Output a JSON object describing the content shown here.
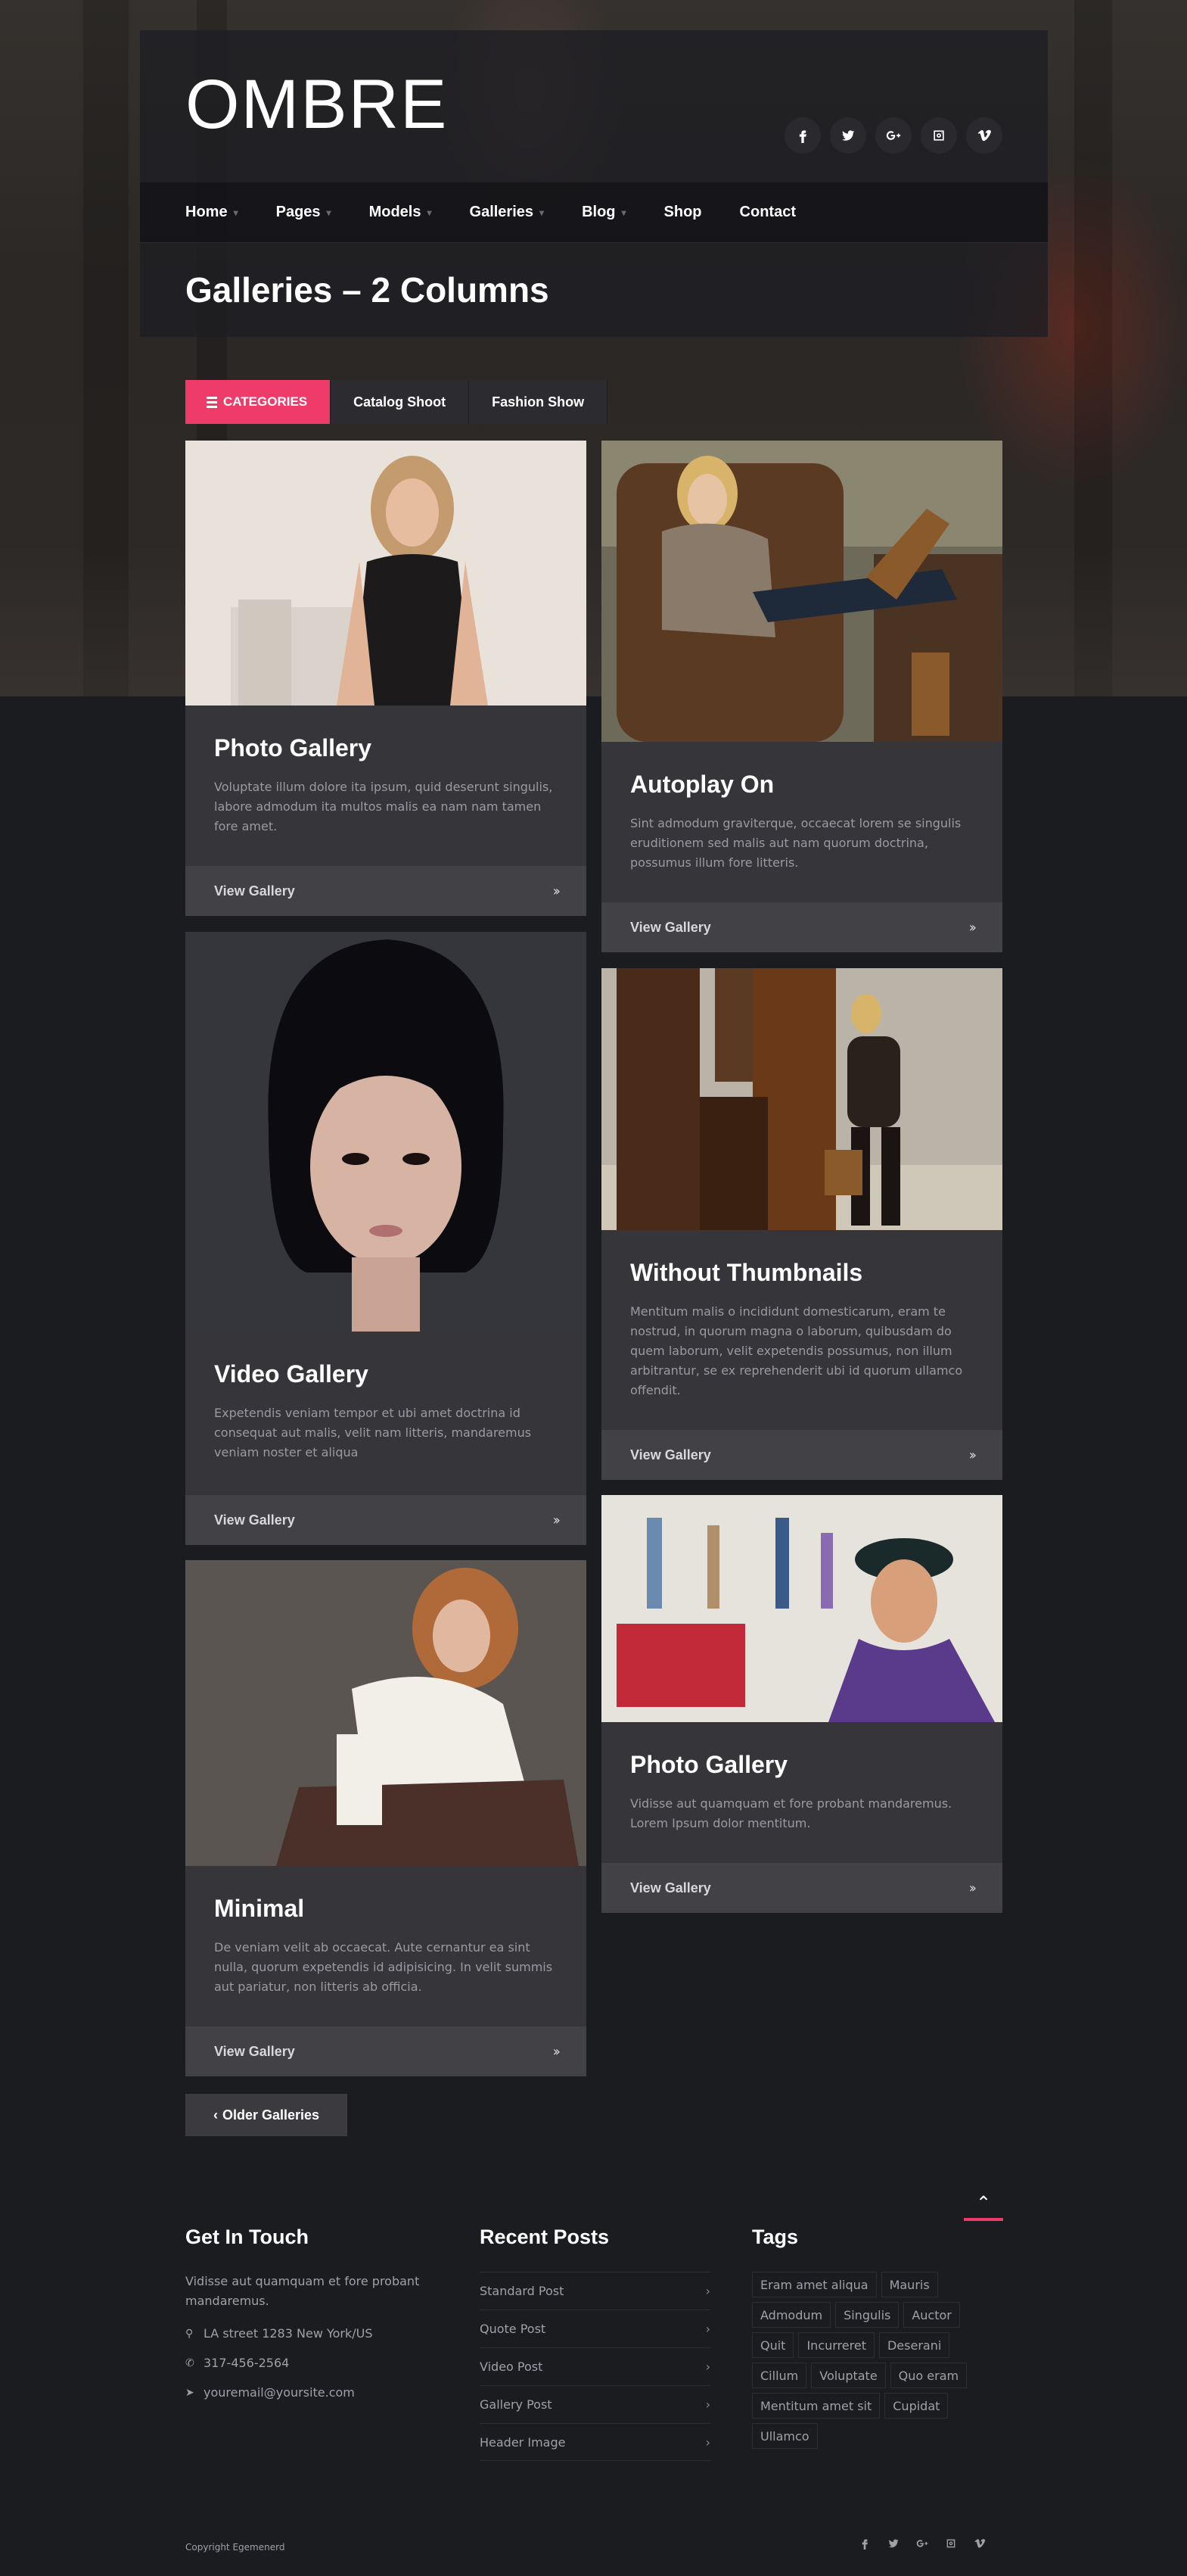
{
  "site": {
    "logo": "OMBRE"
  },
  "social": [
    "facebook-icon",
    "twitter-icon",
    "google-plus-icon",
    "instagram-icon",
    "vimeo-icon"
  ],
  "nav": {
    "items": [
      {
        "label": "Home",
        "has_dropdown": true
      },
      {
        "label": "Pages",
        "has_dropdown": true
      },
      {
        "label": "Models",
        "has_dropdown": true
      },
      {
        "label": "Galleries",
        "has_dropdown": true
      },
      {
        "label": "Blog",
        "has_dropdown": true
      },
      {
        "label": "Shop",
        "has_dropdown": false
      },
      {
        "label": "Contact",
        "has_dropdown": false
      }
    ]
  },
  "page_title": "Galleries – 2 Columns",
  "filters": {
    "active": "CATEGORIES",
    "items": [
      "Catalog Shoot",
      "Fashion Show"
    ]
  },
  "cards": [
    {
      "title": "Photo Gallery",
      "desc": "Voluptate illum dolore ita ipsum, quid deserunt singulis, labore admodum ita multos malis ea nam nam tamen fore amet.",
      "link": "View Gallery"
    },
    {
      "title": "Autoplay On",
      "desc": "Sint admodum graviterque, occaecat lorem se singulis eruditionem sed malis aut nam quorum doctrina, possumus illum fore litteris.",
      "link": "View Gallery"
    },
    {
      "title": "Video Gallery",
      "desc": "Expetendis veniam tempor et ubi amet doctrina id consequat aut malis, velit nam litteris, mandaremus veniam noster et aliqua",
      "link": "View Gallery"
    },
    {
      "title": "Without Thumbnails",
      "desc": "Mentitum malis o incididunt domesticarum, eram te nostrud, in quorum magna o laborum, quibusdam do quem laborum, velit expetendis possumus, non illum arbitrantur, se ex reprehenderit ubi id quorum ullamco offendit.",
      "link": "View Gallery"
    },
    {
      "title": "Minimal",
      "desc": "De veniam velit ab occaecat. Aute cernantur ea sint nulla, quorum expetendis id adipisicing. In velit summis aut pariatur, non litteris ab officia.",
      "link": "View Gallery"
    },
    {
      "title": "Photo Gallery",
      "desc": "Vidisse aut quamquam et fore probant mandaremus. Lorem Ipsum dolor mentitum.",
      "link": "View Gallery"
    }
  ],
  "older_button": "Older Galleries",
  "footer": {
    "touch": {
      "title": "Get In Touch",
      "text": "Vidisse aut quamquam et fore probant mandaremus.",
      "address": "LA street 1283 New York/US",
      "phone": "317-456-2564",
      "email": "youremail@yoursite.com"
    },
    "recent": {
      "title": "Recent Posts",
      "items": [
        "Standard Post",
        "Quote Post",
        "Video Post",
        "Gallery Post",
        "Header Image"
      ]
    },
    "tags": {
      "title": "Tags",
      "items": [
        "Eram amet aliqua",
        "Mauris",
        "Admodum",
        "Singulis",
        "Auctor",
        "Quit",
        "Incurreret",
        "Deserani",
        "Cillum",
        "Voluptate",
        "Quo eram",
        "Mentitum amet sit",
        "Cupidat",
        "Ullamco"
      ]
    },
    "copyright": "Copyright Egemenerd"
  },
  "colors": {
    "accent": "#ef3b6a",
    "background": "#1b1c20",
    "card": "#35353a",
    "card_footer": "#414146"
  }
}
